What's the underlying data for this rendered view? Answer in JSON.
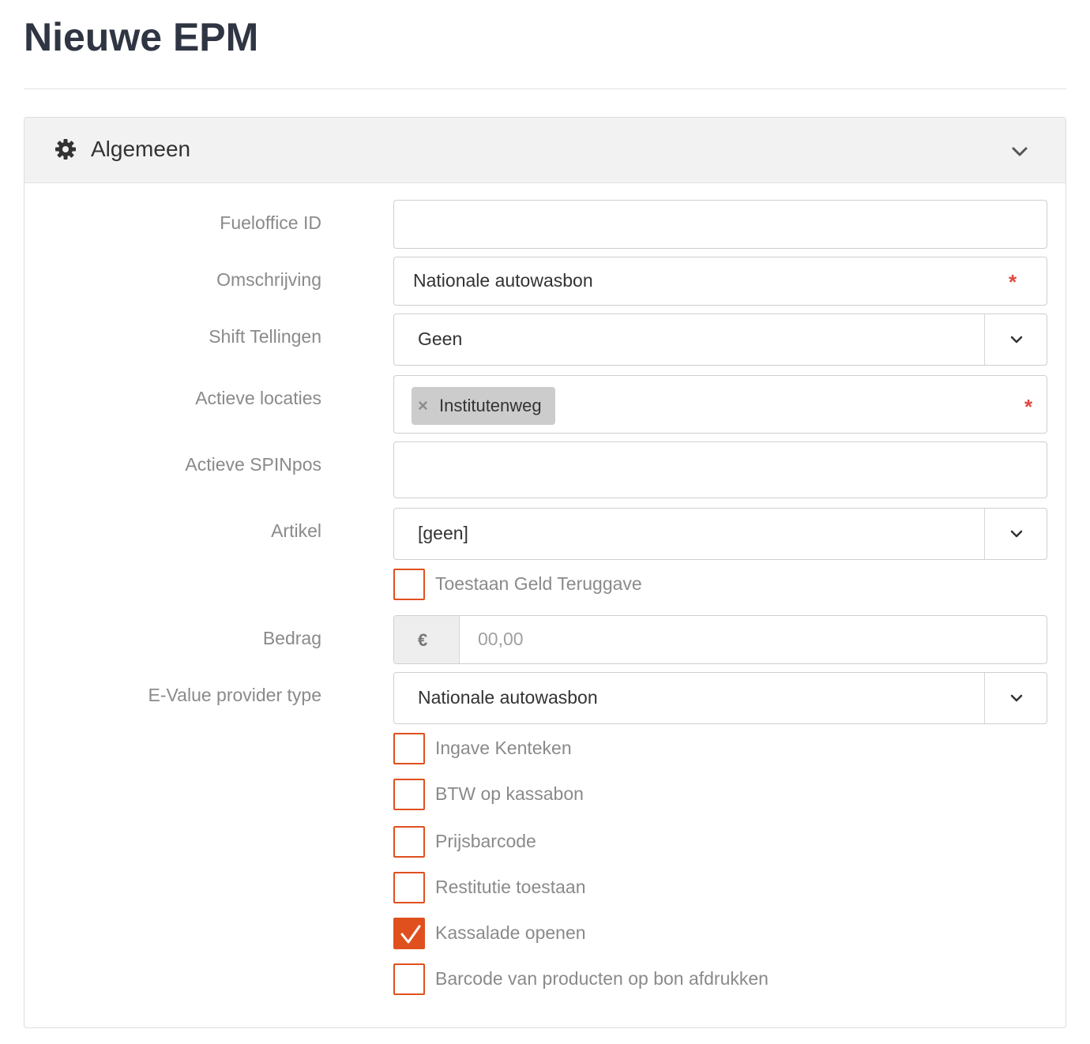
{
  "page": {
    "title": "Nieuwe EPM"
  },
  "panel": {
    "title": "Algemeen",
    "header_icon": "gear-icon",
    "collapse_icon": "chevron-down-icon"
  },
  "form": {
    "fueloffice_id": {
      "label": "Fueloffice ID",
      "value": ""
    },
    "omschrijving": {
      "label": "Omschrijving",
      "value": "Nationale autowasbon",
      "required_mark": "*"
    },
    "shift_tellingen": {
      "label": "Shift Tellingen",
      "selected": "Geen"
    },
    "actieve_locaties": {
      "label": "Actieve locaties",
      "tags": [
        "Institutenweg"
      ],
      "tag_remove": "×",
      "required_mark": "*"
    },
    "actieve_spinpos": {
      "label": "Actieve SPINpos",
      "value": ""
    },
    "artikel": {
      "label": "Artikel",
      "selected": "[geen]"
    },
    "toestaan_geld_teruggave": {
      "label": "Toestaan Geld Teruggave",
      "checked": false
    },
    "bedrag": {
      "label": "Bedrag",
      "currency": "€",
      "placeholder": "00,00"
    },
    "evalue_provider_type": {
      "label": "E-Value provider type",
      "selected": "Nationale autowasbon"
    },
    "options": [
      {
        "label": "Ingave Kenteken",
        "checked": false
      },
      {
        "label": "BTW op kassabon",
        "checked": false
      },
      {
        "label": "Prijsbarcode",
        "checked": false
      },
      {
        "label": "Restitutie toestaan",
        "checked": false
      },
      {
        "label": "Kassalade openen",
        "checked": true
      },
      {
        "label": "Barcode van producten op bon afdrukken",
        "checked": false
      }
    ]
  },
  "colors": {
    "accent": "#e0501f",
    "required": "#e0483e",
    "title": "#2f3542"
  }
}
